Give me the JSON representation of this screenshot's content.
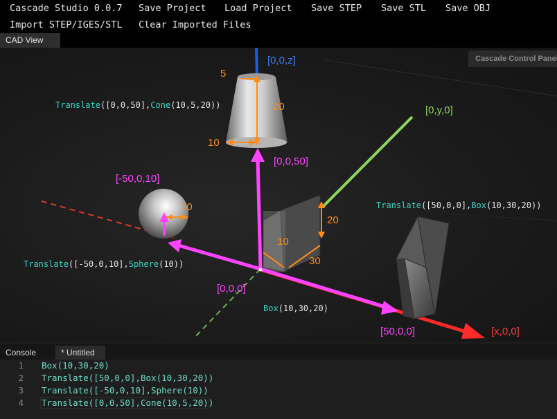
{
  "menu": {
    "title": "Cascade Studio 0.0.7",
    "save_project": "Save Project",
    "load_project": "Load Project",
    "save_step": "Save STEP",
    "save_stl": "Save STL",
    "save_obj": "Save OBJ",
    "import": "Import STEP/IGES/STL",
    "clear_imported": "Clear Imported Files"
  },
  "tabs": {
    "cad_view": "CAD View",
    "console": "Console",
    "untitled": "* Untitled"
  },
  "control_panel": "Cascade Control Panel",
  "viewport": {
    "axes": {
      "z": "[0,0,z]",
      "y": "[0,y,0]",
      "x": "[x,0,0]",
      "origin": "[0,0,0]"
    },
    "points": {
      "cone_center": "[0,0,50]",
      "sphere_center": "[-50,0,10]",
      "box2_offset": "[50,0,0]"
    },
    "dimensions": {
      "cone_top_radius": "5",
      "cone_height": "20",
      "cone_bottom_radius": "10",
      "sphere_radius": "10",
      "box_x": "10",
      "box_y": "30",
      "box_z": "20"
    },
    "captions": {
      "cone": {
        "fn1": "Translate",
        "a1": "([0,0,50],",
        "fn2": "Cone",
        "a2": "(10,5,20))"
      },
      "sphere": {
        "fn1": "Translate",
        "a1": "([-50,0,10],",
        "fn2": "Sphere",
        "a2": "(10))"
      },
      "box2": {
        "fn1": "Translate",
        "a1": "([50,0,0],",
        "fn2": "Box",
        "a2": "(10,30,20))"
      },
      "box": {
        "fn1": "Box",
        "a1": "(10,30,20)"
      }
    },
    "colors": {
      "x_axis": "#ff2a2a",
      "y_axis": "#8fd65a",
      "z_axis": "#1f5fd6",
      "translate_arrow": "#ff44ff",
      "dimension": "#ff8c1a"
    }
  },
  "editor": {
    "lines": [
      {
        "num": "1",
        "code": "Box(10,30,20)"
      },
      {
        "num": "2",
        "code": "Translate([50,0,0],Box(10,30,20))"
      },
      {
        "num": "3",
        "code": "Translate([-50,0,10],Sphere(10))"
      },
      {
        "num": "4",
        "code": "Translate([0,0,50],Cone(10,5,20))"
      }
    ]
  }
}
